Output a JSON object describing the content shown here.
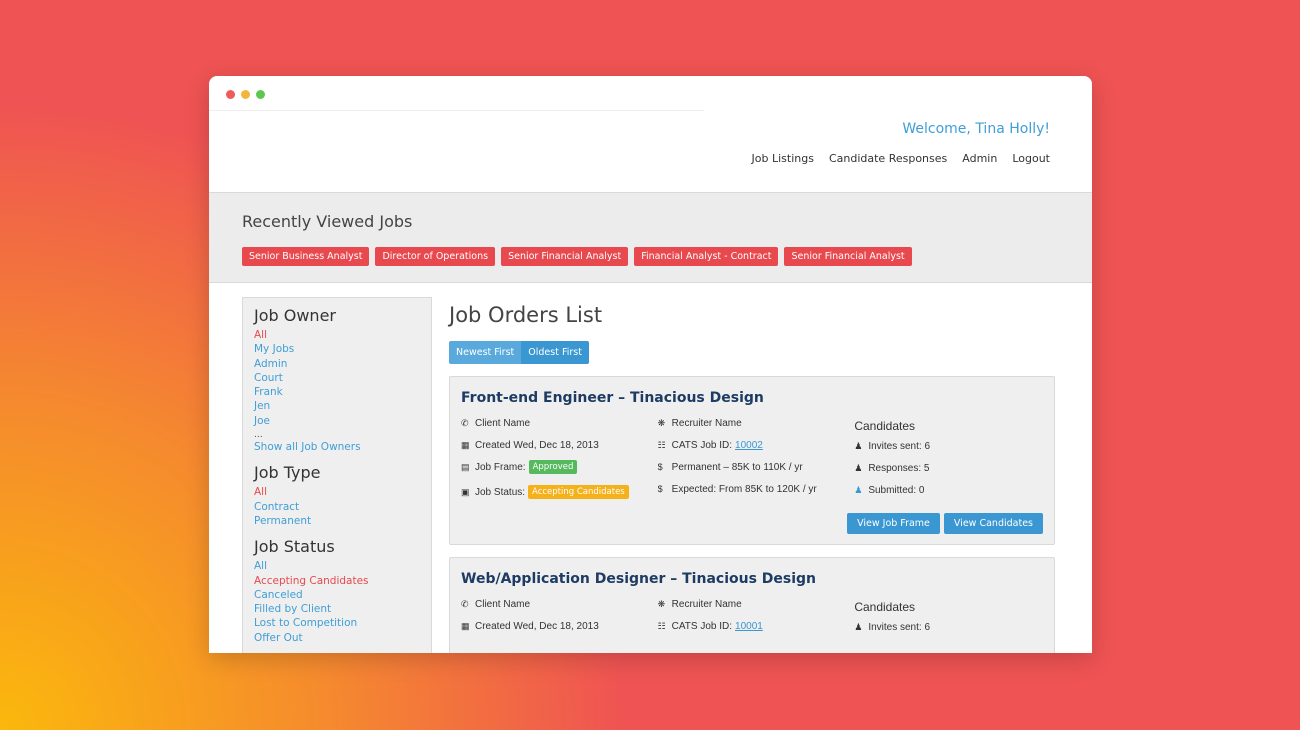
{
  "header": {
    "welcome": "Welcome, Tina Holly!",
    "nav": [
      "Job Listings",
      "Candidate Responses",
      "Admin",
      "Logout"
    ]
  },
  "recent": {
    "title": "Recently Viewed Jobs",
    "jobs": [
      "Senior Business Analyst",
      "Director of Operations",
      "Senior Financial Analyst",
      "Financial Analyst - Contract",
      "Senior Financial Analyst"
    ]
  },
  "sidebar": {
    "job_owner": {
      "title": "Job Owner",
      "items": [
        "All",
        "My Jobs",
        "Admin",
        "Court",
        "Frank",
        "Jen",
        "Joe"
      ],
      "ellipsis": "...",
      "show_all": "Show all Job Owners"
    },
    "job_type": {
      "title": "Job Type",
      "items": [
        "All",
        "Contract",
        "Permanent"
      ]
    },
    "job_status": {
      "title": "Job Status",
      "items": [
        "All",
        "Accepting Candidates",
        "Canceled",
        "Filled by Client",
        "Lost to Competition",
        "Offer Out"
      ]
    }
  },
  "main": {
    "title": "Job Orders List",
    "sort": [
      "Newest First",
      "Oldest First"
    ],
    "cards": [
      {
        "title": "Front-end Engineer – Tinacious Design",
        "client": "Client Name",
        "created": "Created Wed, Dec 18, 2013",
        "job_frame_label": "Job Frame:",
        "job_frame_status": "Approved",
        "job_status_label": "Job Status:",
        "job_status_value": "Accepting Candidates",
        "recruiter": "Recruiter Name",
        "cats_label": "CATS Job ID:",
        "cats_id": "10002",
        "permanent": "Permanent – 85K to 110K / yr",
        "expected": "Expected: From 85K to 120K / yr",
        "candidates_title": "Candidates",
        "invites": "Invites sent: 6",
        "responses": "Responses: 5",
        "submitted": "Submitted: 0",
        "btn_frame": "View Job Frame",
        "btn_candidates": "View Candidates"
      },
      {
        "title": "Web/Application Designer – Tinacious Design",
        "client": "Client Name",
        "created": "Created Wed, Dec 18, 2013",
        "recruiter": "Recruiter Name",
        "cats_label": "CATS Job ID:",
        "cats_id": "10001",
        "candidates_title": "Candidates",
        "invites": "Invites sent: 6"
      }
    ]
  },
  "colors": {
    "accent_blue": "#3a97d2",
    "accent_red": "#e8494f",
    "badge_green": "#55b95d",
    "badge_orange": "#f5b11a",
    "background": "#ef5353"
  },
  "icons": {
    "phone": "phone-icon",
    "calendar": "calendar-icon",
    "document": "document-icon",
    "briefcase": "briefcase-icon",
    "recruiter": "recruiter-icon",
    "barcode": "barcode-icon",
    "dollar": "dollar-icon",
    "person": "person-icon"
  }
}
